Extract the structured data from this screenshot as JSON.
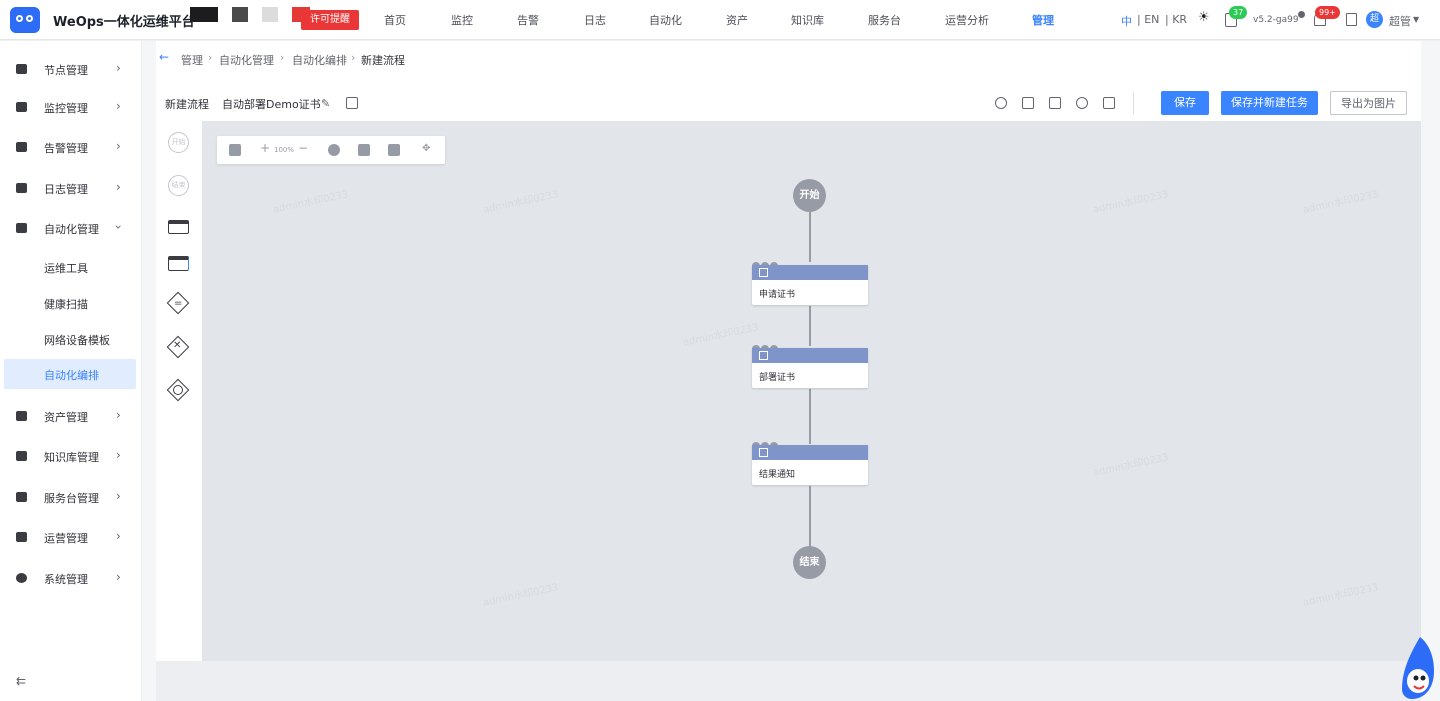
{
  "topbar": {
    "app_title": "WeOps一体化运维平台",
    "license": "许可提醒",
    "nav": [
      "首页",
      "监控",
      "告警",
      "日志",
      "自动化",
      "资产",
      "知识库",
      "服务台",
      "运营分析",
      "管理"
    ],
    "active_nav": "管理",
    "lang": {
      "zh": "中",
      "en": "| EN",
      "kr": "| KR"
    },
    "notice_badge": "37",
    "version": "v5.2-ga99",
    "alert_badge": "99+",
    "user_initial": "超",
    "user_name": "超管"
  },
  "sidebar": {
    "items": [
      {
        "label": "节点管理",
        "icon": "node-icon"
      },
      {
        "label": "监控管理",
        "icon": "monitor-icon"
      },
      {
        "label": "告警管理",
        "icon": "alarm-icon"
      },
      {
        "label": "日志管理",
        "icon": "log-icon"
      },
      {
        "label": "自动化管理",
        "icon": "automation-icon"
      },
      {
        "label": "资产管理",
        "icon": "asset-icon"
      },
      {
        "label": "知识库管理",
        "icon": "knowledge-icon"
      },
      {
        "label": "服务台管理",
        "icon": "service-icon"
      },
      {
        "label": "运营管理",
        "icon": "operation-icon"
      },
      {
        "label": "系统管理",
        "icon": "system-icon"
      }
    ],
    "sub_items": [
      "运维工具",
      "健康扫描",
      "网络设备模板",
      "自动化编排"
    ],
    "active_sub": "自动化编排",
    "collapse_label": "⇇"
  },
  "breadcrumb": {
    "back": "←",
    "items": [
      "管理",
      "自动化管理",
      "自动化编排",
      "新建流程"
    ],
    "sep": "›"
  },
  "flow": {
    "name": "新建流程",
    "template": "自动部署Demo证书"
  },
  "actions": {
    "save": "保存",
    "save_and_new_task": "保存并新建任务",
    "export_image": "导出为图片"
  },
  "palette": {
    "start": "开始",
    "end": "结束"
  },
  "canvas": {
    "zoom": "100%",
    "start_label": "开始",
    "end_label": "结束",
    "tasks": [
      "申请证书",
      "部署证书",
      "结果通知"
    ]
  },
  "watermark": "admin水印0233",
  "colors": {
    "primary": "#3a84ff",
    "license_red": "#ea3636",
    "badge_green": "#2dcb56",
    "badge_red": "#ea3636",
    "task_header": "#7f94c8",
    "node_gray": "#979ba5",
    "canvas_bg": "#e2e5ea"
  }
}
